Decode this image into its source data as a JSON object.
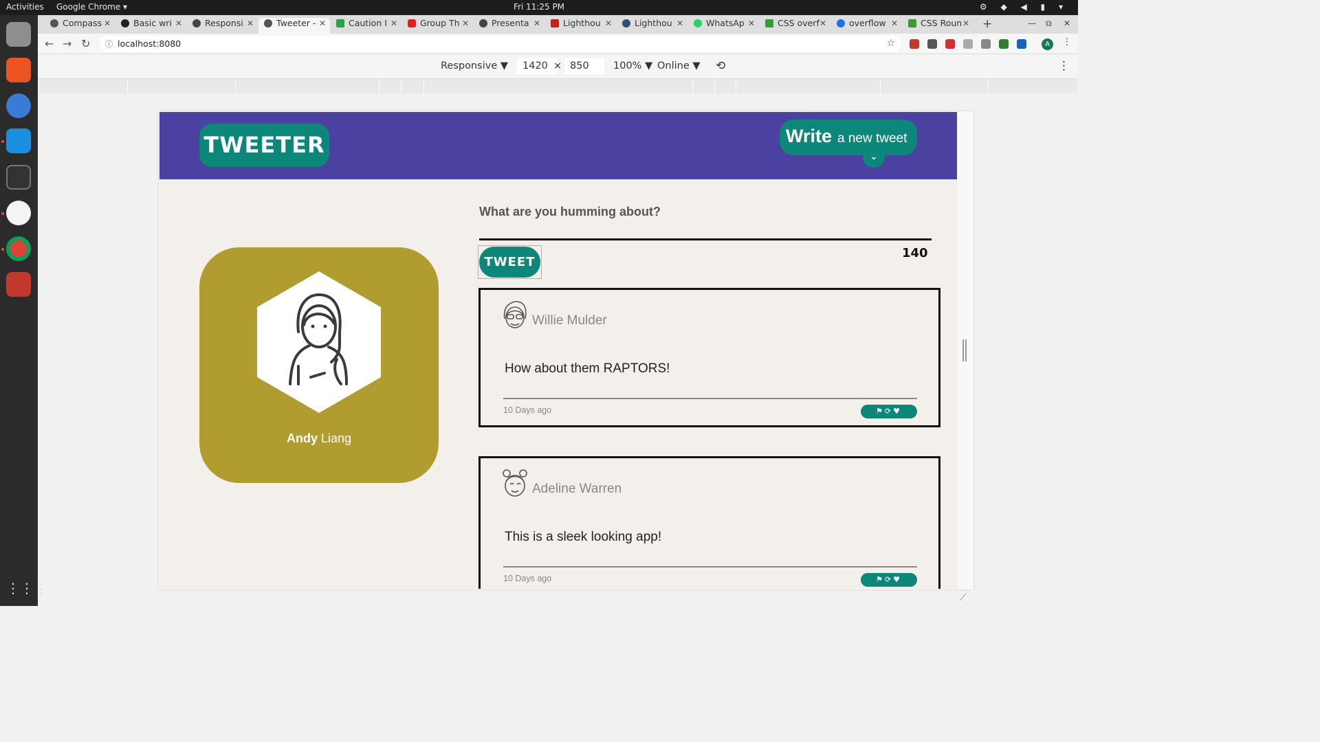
{
  "os": {
    "activities": "Activities",
    "app_name": "Google Chrome ▾",
    "clock": "Fri 11:25 PM"
  },
  "browser": {
    "tabs": [
      {
        "label": "Compass",
        "color": "#555555"
      },
      {
        "label": "Basic wri",
        "color": "#222222"
      },
      {
        "label": "Responsi",
        "color": "#444444"
      },
      {
        "label": "Tweeter -",
        "color": "#555555"
      },
      {
        "label": "Caution I",
        "color": "#25a345"
      },
      {
        "label": "Group Th",
        "color": "#e02020"
      },
      {
        "label": "Presenta",
        "color": "#444444"
      },
      {
        "label": "Lighthou",
        "color": "#c5221f"
      },
      {
        "label": "Lighthou",
        "color": "#2e4f7a"
      },
      {
        "label": "WhatsAp",
        "color": "#25d366"
      },
      {
        "label": "CSS overf",
        "color": "#3a9a3a"
      },
      {
        "label": "overflow",
        "color": "#1a73e8"
      },
      {
        "label": "CSS Roun",
        "color": "#3a9a3a"
      }
    ],
    "url": "localhost:8080",
    "avatar_letter": "A"
  },
  "devtools": {
    "device": "Responsive ▼",
    "width": "1420",
    "times": "×",
    "height": "850",
    "zoom": "100% ▼",
    "network": "Online ▼"
  },
  "app": {
    "logo": "TWEETER",
    "compose_bold": "Write",
    "compose_rest": "a new tweet",
    "question": "What are you humming about?",
    "tweet_button": "TWEET",
    "counter": "140",
    "profile": {
      "first": "Andy",
      "last": "Liang"
    },
    "tweets": [
      {
        "author": "Willie Mulder",
        "text": "How about them RAPTORS!",
        "time": "10 Days ago"
      },
      {
        "author": "Adeline Warren",
        "text": "This is a sleek looking app!",
        "time": "10 Days ago"
      }
    ]
  }
}
